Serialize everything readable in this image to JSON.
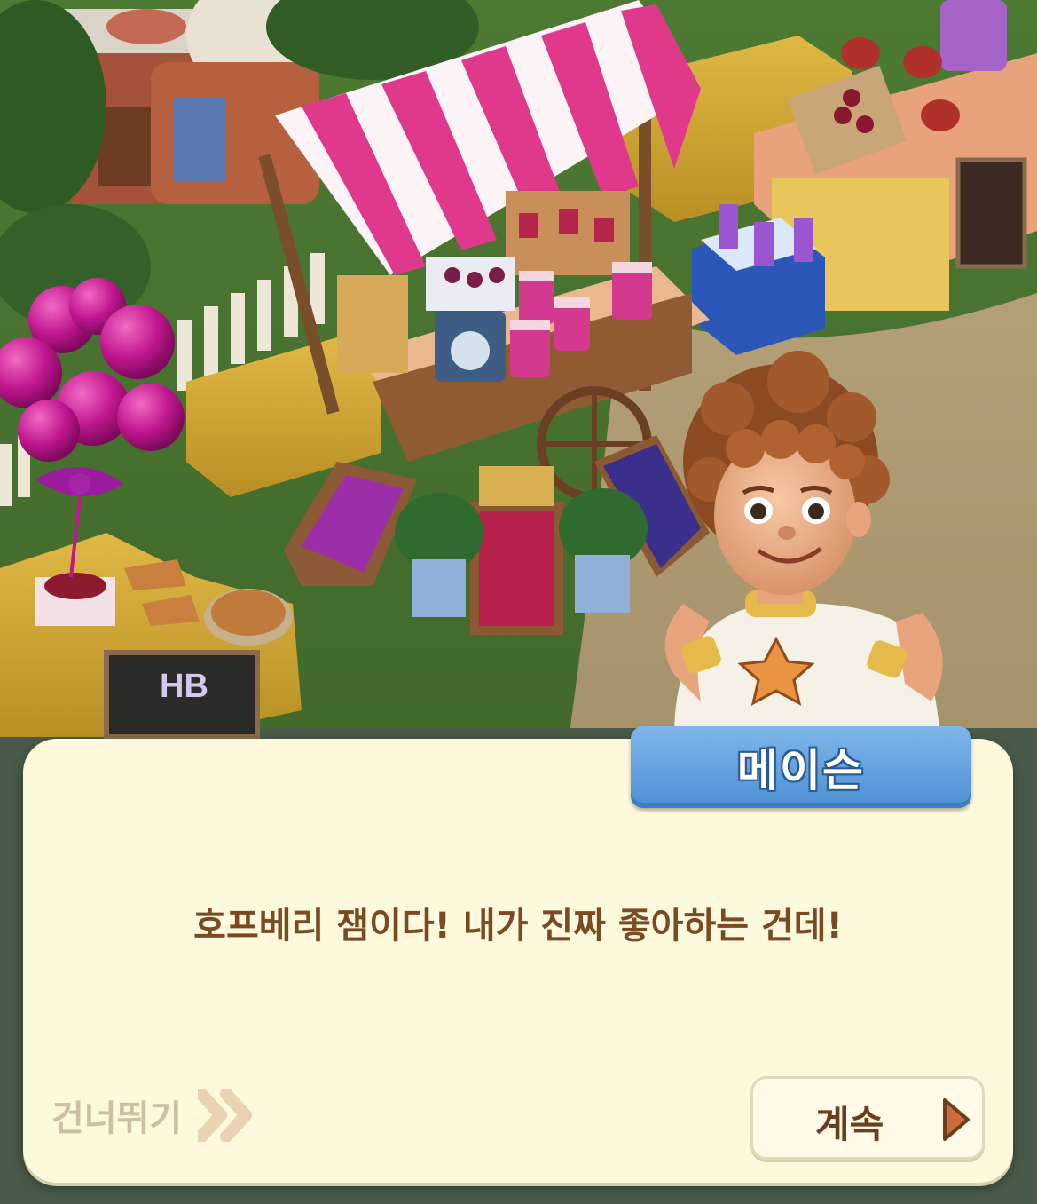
{
  "dialog": {
    "speaker_name": "메이슨",
    "message": "호프베리 잼이다! 내가 진짜 좋아하는 건데!",
    "skip_label": "건너뛰기",
    "continue_label": "계속"
  },
  "scene": {
    "sign_text": "HB",
    "accent_colors": {
      "awning_pink": "#e0398c",
      "balloon_magenta": "#c0168f",
      "dialog_bg": "#fdf9dc",
      "nameplate_blue": "#5b9ee0",
      "text_brown": "#7a4a23"
    }
  },
  "icons": {
    "skip": "double-chevron-right-icon",
    "continue": "play-triangle-icon"
  }
}
